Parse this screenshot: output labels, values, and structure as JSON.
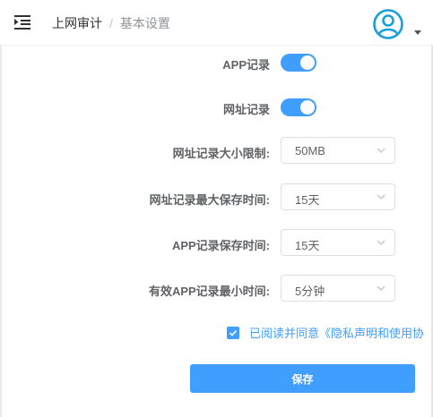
{
  "header": {
    "breadcrumb_parent": "上网审计",
    "breadcrumb_separator": "/",
    "breadcrumb_current": "基本设置"
  },
  "icons": {
    "menu": "menu-fold-icon",
    "avatar": "user-avatar-icon",
    "caret": "caret-down-icon",
    "select_arrow": "chevron-down-icon",
    "checkbox": "check-icon"
  },
  "form": {
    "app_record": {
      "label": "APP记录",
      "enabled": true
    },
    "url_record": {
      "label": "网址记录",
      "enabled": true
    },
    "url_size_limit": {
      "label": "网址记录大小限制:",
      "value": "50MB"
    },
    "url_max_retention": {
      "label": "网址记录最大保存时间:",
      "value": "15天"
    },
    "app_retention": {
      "label": "APP记录保存时间:",
      "value": "15天"
    },
    "app_min_duration": {
      "label": "有效APP记录最小时间:",
      "value": "5分钟"
    },
    "agreement": {
      "checked": true,
      "text": "已阅读并同意《隐私声明和使用协"
    },
    "save_label": "保存"
  },
  "colors": {
    "accent": "#409eff",
    "label": "#606266",
    "border": "#dcdfe6"
  }
}
